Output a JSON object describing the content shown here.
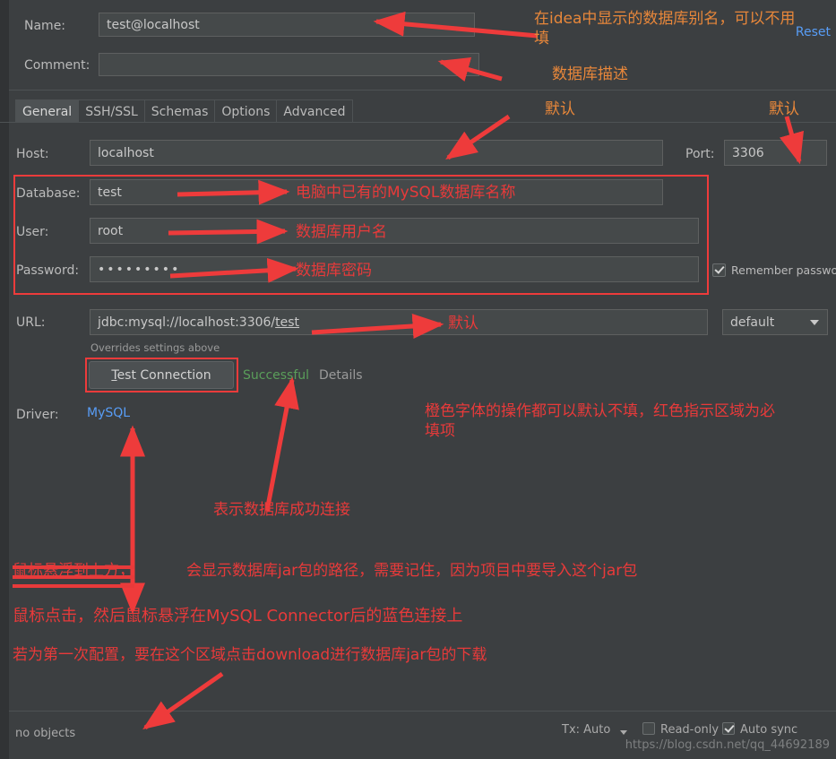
{
  "window": {
    "background": "#3c3f41",
    "accent_link": "#589df6",
    "success_color": "#5a9e5a",
    "annotation_red": "#e83a3a",
    "annotation_orange": "#e8873a"
  },
  "header": {
    "name_label": "Name:",
    "name_value": "test@localhost",
    "comment_label": "Comment:",
    "comment_value": "",
    "comment_placeholder": "",
    "reset_link": "Reset",
    "expand_icon": "↗"
  },
  "tabs": [
    {
      "label": "General",
      "active": true
    },
    {
      "label": "SSH/SSL",
      "active": false
    },
    {
      "label": "Schemas",
      "active": false
    },
    {
      "label": "Options",
      "active": false
    },
    {
      "label": "Advanced",
      "active": false
    }
  ],
  "general": {
    "host_label": "Host:",
    "host_value": "localhost",
    "port_label": "Port:",
    "port_value": "3306",
    "database_label": "Database:",
    "database_value": "test",
    "user_label": "User:",
    "user_value": "root",
    "password_label": "Password:",
    "password_value": "•••••••••",
    "remember_password_label": "Remember password",
    "remember_password_checked": true,
    "url_label": "URL:",
    "url_value": "jdbc:mysql://localhost:3306/test",
    "url_underlined_part": "test",
    "url_prefix_part": "jdbc:mysql://localhost:3306/",
    "url_hint": "Overrides settings above",
    "url_scheme_value": "default",
    "test_connection_label": "Test Connection",
    "test_connection_mnemonic": "T",
    "test_result": "Successful",
    "details_link": "Details",
    "driver_label": "Driver:",
    "driver_value": "MySQL"
  },
  "statusbar": {
    "objects_text": "no objects",
    "tx_label": "Tx: Auto",
    "readonly_label": "Read-only",
    "readonly_checked": false,
    "autosync_label": "Auto sync",
    "autosync_checked": true,
    "watermark": "https://blog.csdn.net/qq_44692189"
  },
  "annotations": [
    {
      "id": "name-note",
      "text": "在idea中显示的数据库别名，可以不用\n填",
      "color": "orange"
    },
    {
      "id": "comment-note",
      "text": "数据库描述",
      "color": "orange"
    },
    {
      "id": "host-note",
      "text": "默认",
      "color": "orange"
    },
    {
      "id": "port-note",
      "text": "默认",
      "color": "orange"
    },
    {
      "id": "database-note",
      "text": "电脑中已有的MySQL数据库名称",
      "color": "red"
    },
    {
      "id": "user-note",
      "text": "数据库用户名",
      "color": "red"
    },
    {
      "id": "password-note",
      "text": "数据库密码",
      "color": "red"
    },
    {
      "id": "url-note",
      "text": "默认",
      "color": "orange"
    },
    {
      "id": "legend-note",
      "text": "橙色字体的操作都可以默认不填，红色指示区域为必\n填项",
      "color": "red"
    },
    {
      "id": "successful-note",
      "text": "表示数据库成功连接",
      "color": "red"
    },
    {
      "id": "struck-note",
      "text": "鼠标悬浮到上方，",
      "color": "red"
    },
    {
      "id": "jar-path-note",
      "text": "会显示数据库jar包的路径，需要记住，因为项目中要导入这个jar包",
      "color": "red"
    },
    {
      "id": "hover-note",
      "text": "鼠标点击，然后鼠标悬浮在MySQL Connector后的蓝色连接上",
      "color": "red"
    },
    {
      "id": "download-note",
      "text": "若为第一次配置，要在这个区域点击download进行数据库jar包的下载",
      "color": "red"
    }
  ]
}
